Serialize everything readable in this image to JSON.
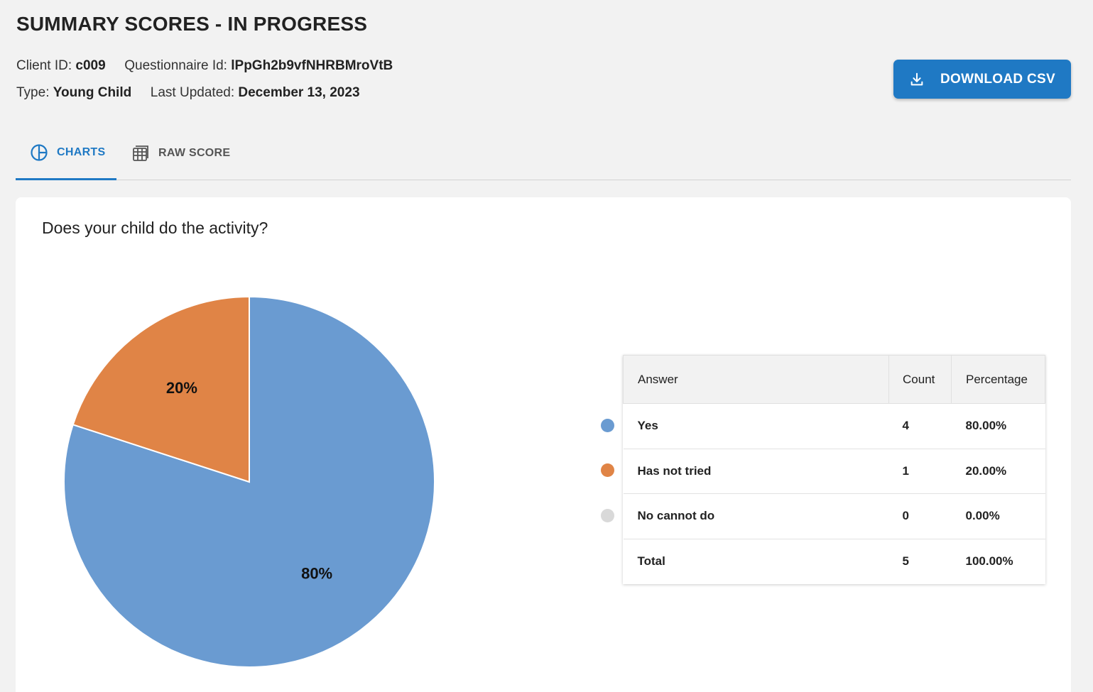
{
  "header": {
    "title": "SUMMARY SCORES - IN PROGRESS",
    "client_id_label": "Client ID:",
    "client_id": "c009",
    "questionnaire_label": "Questionnaire Id:",
    "questionnaire_id": "lPpGh2b9vfNHRBMroVtB",
    "type_label": "Type:",
    "type": "Young Child",
    "updated_label": "Last Updated:",
    "updated": "December 13, 2023",
    "download_label": "DOWNLOAD CSV"
  },
  "tabs": [
    {
      "label": "CHARTS",
      "icon": "pie-chart-icon",
      "active": true
    },
    {
      "label": "RAW SCORE",
      "icon": "table-icon",
      "active": false
    }
  ],
  "card": {
    "question": "Does your child do the activity?"
  },
  "table": {
    "headers": [
      "Answer",
      "Count",
      "Percentage"
    ],
    "rows": [
      {
        "answer": "Yes",
        "count": "4",
        "percentage": "80.00%",
        "color": "#6a9bd1"
      },
      {
        "answer": "Has not tried",
        "count": "1",
        "percentage": "20.00%",
        "color": "#e08446"
      },
      {
        "answer": "No cannot do",
        "count": "0",
        "percentage": "0.00%",
        "color": "#d9d9d9"
      }
    ],
    "total": {
      "answer": "Total",
      "count": "5",
      "percentage": "100.00%"
    }
  },
  "chart_data": {
    "type": "pie",
    "categories": [
      "Yes",
      "Has not tried",
      "No cannot do"
    ],
    "values": [
      4,
      1,
      0
    ],
    "labels": [
      "80%",
      "20%",
      ""
    ],
    "colors": [
      "#6a9bd1",
      "#e08446",
      "#d9d9d9"
    ]
  },
  "colors": {
    "accent": "#1f79c4",
    "background": "#f2f2f2"
  }
}
